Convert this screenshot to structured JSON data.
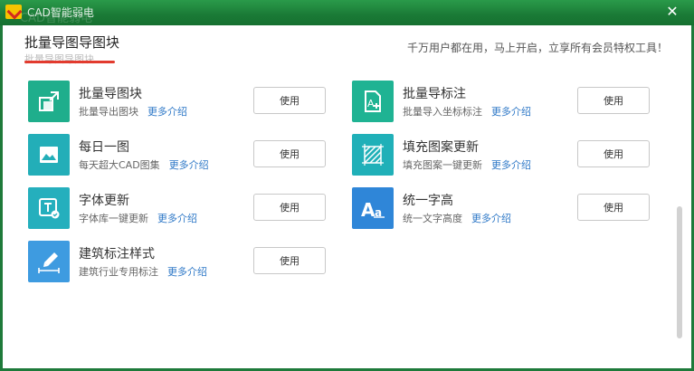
{
  "window": {
    "title": "CAD智能弱电",
    "close_symbol": "✕"
  },
  "header": {
    "title": "批量导图导图块",
    "subtitle": "批量导图导图块",
    "slogan": "千万用户都在用，马上开启，立享所有会员特权工具！"
  },
  "features": [
    {
      "title": "批量导图块",
      "desc": "批量导出图块",
      "more": "更多介绍",
      "button": "使用",
      "color": "#1fae8c",
      "icon": "export-block-icon"
    },
    {
      "title": "批量导标注",
      "desc": "批量导入坐标标注",
      "more": "更多介绍",
      "button": "使用",
      "color": "#1fb393",
      "icon": "document-add-icon"
    },
    {
      "title": "每日一图",
      "desc": "每天超大CAD图集",
      "more": "更多介绍",
      "button": "使用",
      "color": "#23aeb8",
      "icon": "image-icon"
    },
    {
      "title": "填充图案更新",
      "desc": "填充图案一键更新",
      "more": "更多介绍",
      "button": "使用",
      "color": "#20b0b8",
      "icon": "hatch-pattern-icon"
    },
    {
      "title": "字体更新",
      "desc": "字体库一键更新",
      "more": "更多介绍",
      "button": "使用",
      "color": "#25afbd",
      "icon": "text-font-icon"
    },
    {
      "title": "统一字高",
      "desc": "统一文字高度",
      "more": "更多介绍",
      "button": "使用",
      "color": "#2f86d8",
      "icon": "text-height-icon"
    },
    {
      "title": "建筑标注样式",
      "desc": "建筑行业专用标注",
      "more": "更多介绍",
      "button": "使用",
      "color": "#3e9be0",
      "icon": "dimension-pen-icon"
    }
  ]
}
